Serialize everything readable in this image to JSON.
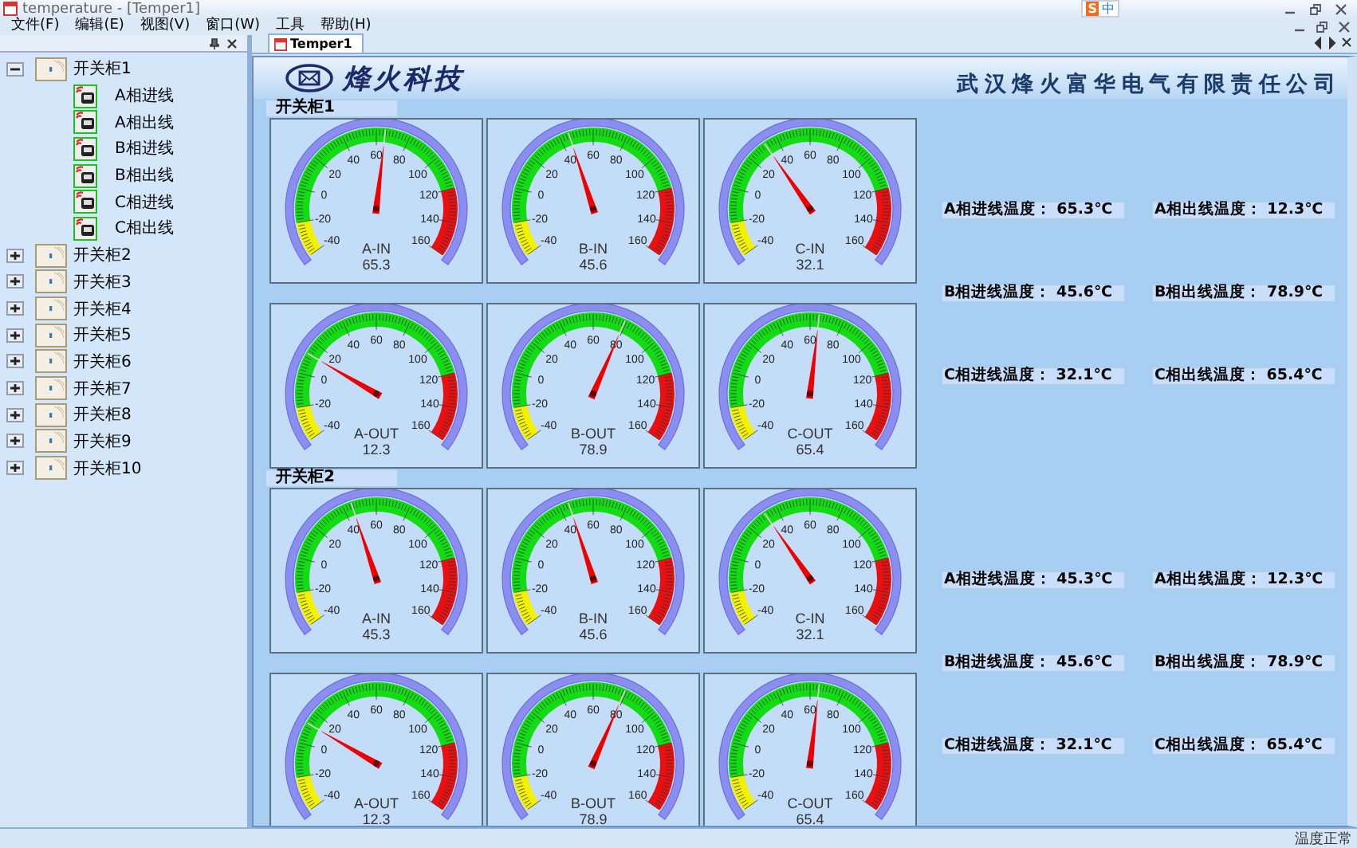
{
  "window": {
    "title": "temperature - [Temper1]"
  },
  "ime_bar": [
    "S",
    "中"
  ],
  "menu": [
    "文件(F)",
    "编辑(E)",
    "视图(V)",
    "窗口(W)",
    "工具",
    "帮助(H)"
  ],
  "tree": [
    {
      "label": "开关柜1",
      "expanded": true,
      "children": [
        {
          "label": "A相进线"
        },
        {
          "label": "A相出线"
        },
        {
          "label": "B相进线"
        },
        {
          "label": "B相出线"
        },
        {
          "label": "C相进线"
        },
        {
          "label": "C相出线"
        }
      ]
    },
    {
      "label": "开关柜2",
      "expanded": false
    },
    {
      "label": "开关柜3",
      "expanded": false
    },
    {
      "label": "开关柜4",
      "expanded": false
    },
    {
      "label": "开关柜5",
      "expanded": false
    },
    {
      "label": "开关柜6",
      "expanded": false
    },
    {
      "label": "开关柜7",
      "expanded": false
    },
    {
      "label": "开关柜8",
      "expanded": false
    },
    {
      "label": "开关柜9",
      "expanded": false
    },
    {
      "label": "开关柜10",
      "expanded": false
    }
  ],
  "tabs": [
    {
      "label": "Temper1",
      "selected": true
    }
  ],
  "header": {
    "brand": "烽火科技",
    "company": "武汉烽火富华电气有限责任公司"
  },
  "groups": [
    {
      "title": "开关柜1",
      "gauges": [
        {
          "label": "A-IN",
          "reading": "65.3",
          "level": 0.5265,
          "scale": [
            "-40",
            "-20",
            "0",
            "20",
            "40",
            "60",
            "80",
            "100",
            "120",
            "140",
            "160"
          ]
        },
        {
          "label": "B-IN",
          "reading": "45.6",
          "level": 0.428,
          "scale": [
            "-40",
            "-20",
            "0",
            "20",
            "40",
            "60",
            "80",
            "100",
            "120",
            "140",
            "160"
          ]
        },
        {
          "label": "C-IN",
          "reading": "32.1",
          "level": 0.3605,
          "scale": [
            "-40",
            "-20",
            "0",
            "20",
            "40",
            "60",
            "80",
            "100",
            "120",
            "140",
            "160"
          ]
        },
        {
          "label": "A-OUT",
          "reading": "12.3",
          "level": 0.2615,
          "scale": [
            "-40",
            "-20",
            "0",
            "20",
            "40",
            "60",
            "80",
            "100",
            "120",
            "140",
            "160"
          ]
        },
        {
          "label": "B-OUT",
          "reading": "78.9",
          "level": 0.5945,
          "scale": [
            "-40",
            "-20",
            "0",
            "20",
            "40",
            "60",
            "80",
            "100",
            "120",
            "140",
            "160"
          ]
        },
        {
          "label": "C-OUT",
          "reading": "65.4",
          "level": 0.527,
          "scale": [
            "-40",
            "-20",
            "0",
            "20",
            "40",
            "60",
            "80",
            "100",
            "120",
            "140",
            "160"
          ]
        }
      ],
      "readouts": [
        "A相进线温度： 65.3℃",
        "A相出线温度： 12.3℃",
        "B相进线温度： 45.6℃",
        "B相出线温度： 78.9℃",
        "C相进线温度： 32.1℃",
        "C相出线温度： 65.4℃"
      ]
    },
    {
      "title": "开关柜2",
      "gauges": [
        {
          "label": "A-IN",
          "reading": "45.3",
          "level": 0.4265,
          "scale": [
            "-40",
            "-20",
            "0",
            "20",
            "40",
            "60",
            "80",
            "100",
            "120",
            "140",
            "160"
          ]
        },
        {
          "label": "B-IN",
          "reading": "45.6",
          "level": 0.428,
          "scale": [
            "-40",
            "-20",
            "0",
            "20",
            "40",
            "60",
            "80",
            "100",
            "120",
            "140",
            "160"
          ]
        },
        {
          "label": "C-IN",
          "reading": "32.1",
          "level": 0.3605,
          "scale": [
            "-40",
            "-20",
            "0",
            "20",
            "40",
            "60",
            "80",
            "100",
            "120",
            "140",
            "160"
          ]
        },
        {
          "label": "A-OUT",
          "reading": "12.3",
          "level": 0.2615,
          "scale": [
            "-40",
            "-20",
            "0",
            "20",
            "40",
            "60",
            "80",
            "100",
            "120",
            "140",
            "160"
          ]
        },
        {
          "label": "B-OUT",
          "reading": "78.9",
          "level": 0.5945,
          "scale": [
            "-40",
            "-20",
            "0",
            "20",
            "40",
            "60",
            "80",
            "100",
            "120",
            "140",
            "160"
          ]
        },
        {
          "label": "C-OUT",
          "reading": "65.4",
          "level": 0.527,
          "scale": [
            "-40",
            "-20",
            "0",
            "20",
            "40",
            "60",
            "80",
            "100",
            "120",
            "140",
            "160"
          ]
        }
      ],
      "readouts": [
        "A相进线温度： 45.3℃",
        "A相出线温度： 12.3℃",
        "B相进线温度： 45.6℃",
        "B相出线温度： 78.9℃",
        "C相进线温度： 32.1℃",
        "C相出线温度： 65.4℃"
      ]
    }
  ],
  "status_bar": "温度正常"
}
